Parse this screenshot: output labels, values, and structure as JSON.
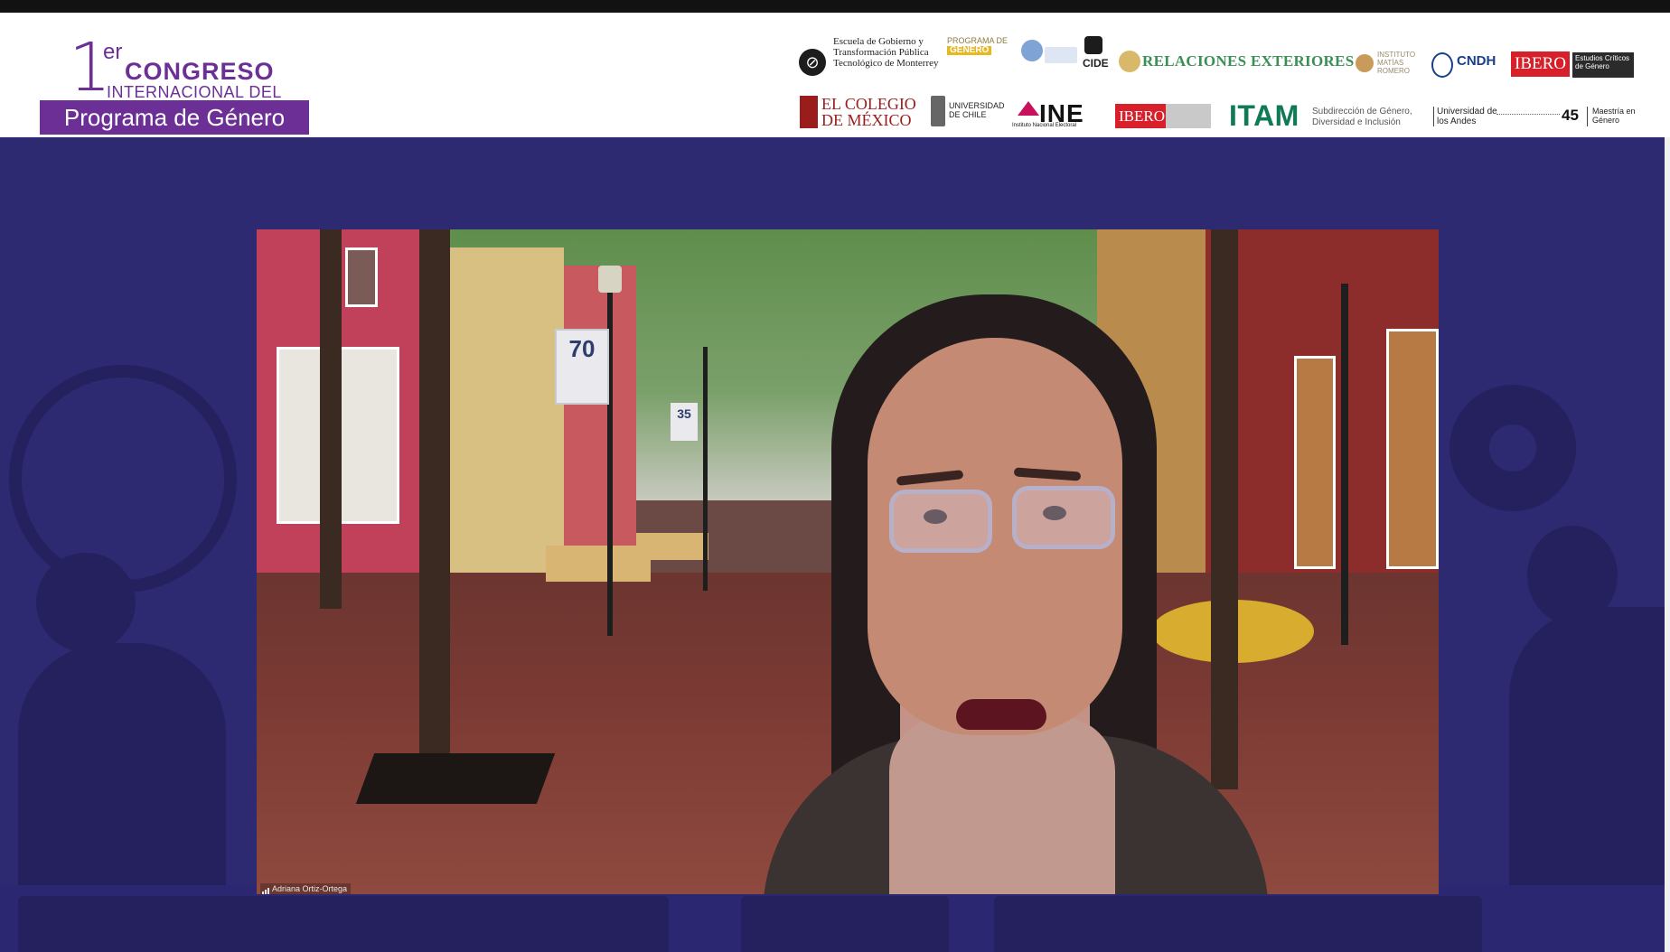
{
  "congress_logo": {
    "number": "1",
    "superscript": "er",
    "line1": "CONGRESO",
    "line2": "INTERNACIONAL DEL",
    "line3": "Programa de Género"
  },
  "sponsors": {
    "row1": {
      "itesm": [
        "Escuela de Gobierno y",
        "Transformación Pública",
        "Tecnológico de Monterrey"
      ],
      "programa_genero": [
        "PROGRAMA DE",
        "GÉNERO"
      ],
      "cide": "CIDE",
      "sre": "RELACIONES EXTERIORES",
      "instituto": [
        "INSTITUTO",
        "MATÍAS",
        "ROMERO"
      ],
      "cndh": "CNDH",
      "ibero": "IBERO",
      "ibero_dark": [
        "Estudios Críticos",
        "de Género"
      ]
    },
    "row2": {
      "colmex": [
        "EL COLEGIO",
        "DE MÉXICO"
      ],
      "uchile": [
        "UNIVERSIDAD",
        "DE CHILE"
      ],
      "ine": "INE",
      "ine_sub": "Instituto Nacional Electoral",
      "ibero2": "IBERO",
      "itam": "ITAM",
      "itam_sub": [
        "Subdirección de Género,",
        "Diversidad e Inclusión"
      ],
      "andes": [
        "Universidad de",
        "los Andes"
      ],
      "years": "45",
      "maestria": [
        "Maestría en",
        "Género"
      ]
    }
  },
  "video": {
    "participant_name": "Adriana Ortiz-Ortega",
    "sign_70": "70",
    "sign_35": "35"
  },
  "colors": {
    "brand_purple": "#6b2f96",
    "stage_bg": "#2e2a72",
    "stage_shape": "#25205e",
    "sre_green": "#3a8f55",
    "ibero_red": "#d7202a",
    "itam_green": "#0f7a56",
    "ine_magenta": "#c8105d"
  }
}
